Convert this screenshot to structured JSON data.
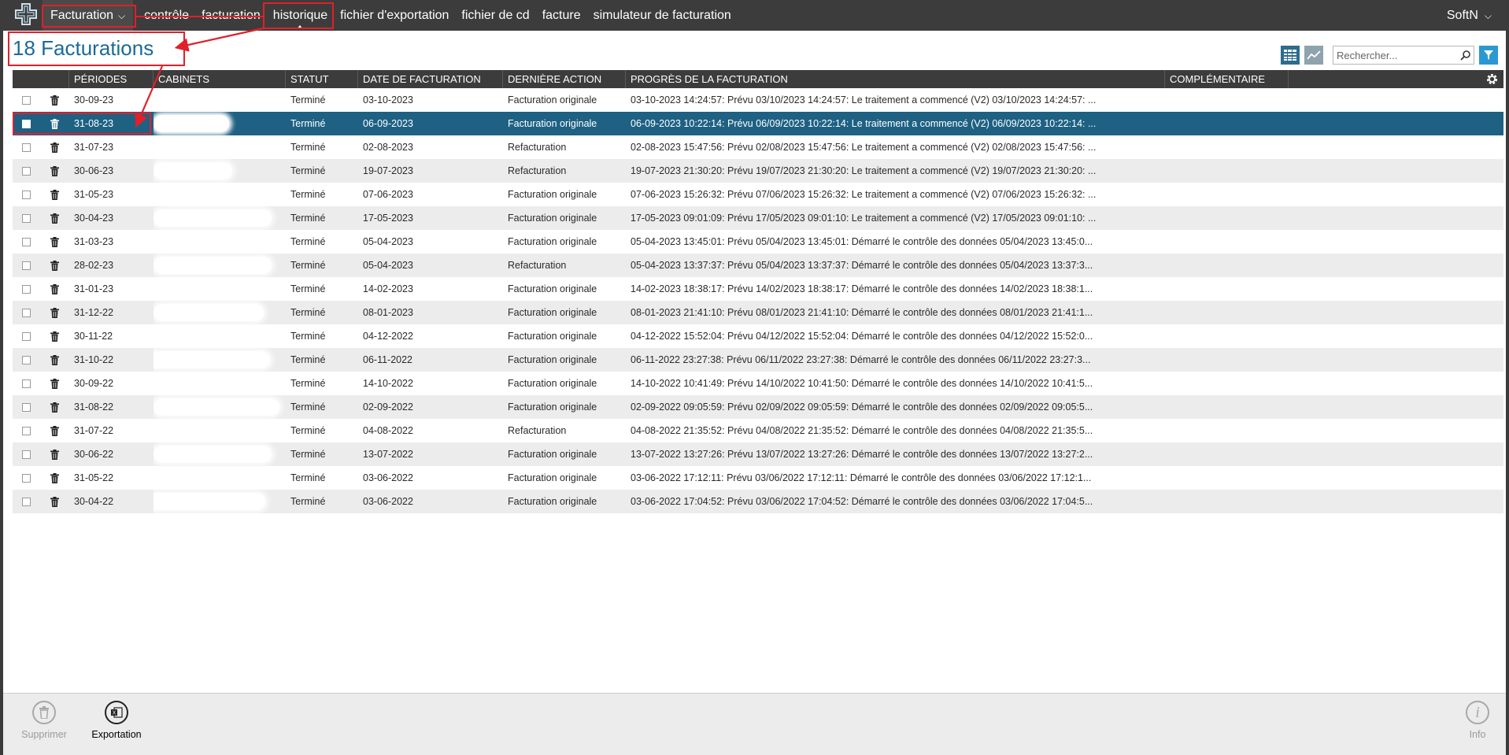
{
  "nav": {
    "module_label": "Facturation",
    "items": [
      "contrôle",
      "facturation",
      "historique",
      "fichier d'exportation",
      "fichier de cd",
      "facture",
      "simulateur de facturation"
    ],
    "active_index": 2,
    "user": "SoftN"
  },
  "page": {
    "title": "18 Facturations"
  },
  "search": {
    "placeholder": "Rechercher..."
  },
  "table": {
    "columns": [
      "PÉRIODES",
      "CABINETS",
      "STATUT",
      "DATE DE FACTURATION",
      "DERNIÈRE ACTION",
      "PROGRÈS DE LA FACTURATION",
      "COMPLÉMENTAIRE"
    ],
    "rows": [
      {
        "period": "30-09-23",
        "status": "Terminé",
        "date": "03-10-2023",
        "action": "Facturation originale",
        "progress": "03-10-2023 14:24:57: Prévu 03/10/2023 14:24:57: Le traitement a commencé (V2) 03/10/2023 14:24:57: ..."
      },
      {
        "period": "31-08-23",
        "status": "Terminé",
        "date": "06-09-2023",
        "action": "Facturation originale",
        "progress": "06-09-2023 10:22:14: Prévu 06/09/2023 10:22:14: Le traitement a commencé (V2) 06/09/2023 10:22:14: ..."
      },
      {
        "period": "31-07-23",
        "status": "Terminé",
        "date": "02-08-2023",
        "action": "Refacturation",
        "progress": "02-08-2023 15:47:56: Prévu 02/08/2023 15:47:56: Le traitement a commencé (V2) 02/08/2023 15:47:56: ..."
      },
      {
        "period": "30-06-23",
        "status": "Terminé",
        "date": "19-07-2023",
        "action": "Refacturation",
        "progress": "19-07-2023 21:30:20: Prévu 19/07/2023 21:30:20: Le traitement a commencé (V2) 19/07/2023 21:30:20: ..."
      },
      {
        "period": "31-05-23",
        "status": "Terminé",
        "date": "07-06-2023",
        "action": "Facturation originale",
        "progress": "07-06-2023 15:26:32: Prévu 07/06/2023 15:26:32: Le traitement a commencé (V2) 07/06/2023 15:26:32: ..."
      },
      {
        "period": "30-04-23",
        "status": "Terminé",
        "date": "17-05-2023",
        "action": "Facturation originale",
        "progress": "17-05-2023 09:01:09: Prévu 17/05/2023 09:01:10: Le traitement a commencé (V2) 17/05/2023 09:01:10: ..."
      },
      {
        "period": "31-03-23",
        "status": "Terminé",
        "date": "05-04-2023",
        "action": "Facturation originale",
        "progress": "05-04-2023 13:45:01: Prévu 05/04/2023 13:45:01: Démarré le contrôle des données 05/04/2023 13:45:0..."
      },
      {
        "period": "28-02-23",
        "status": "Terminé",
        "date": "05-04-2023",
        "action": "Refacturation",
        "progress": "05-04-2023 13:37:37: Prévu 05/04/2023 13:37:37: Démarré le contrôle des données 05/04/2023 13:37:3..."
      },
      {
        "period": "31-01-23",
        "status": "Terminé",
        "date": "14-02-2023",
        "action": "Facturation originale",
        "progress": "14-02-2023 18:38:17: Prévu 14/02/2023 18:38:17: Démarré le contrôle des données 14/02/2023 18:38:1..."
      },
      {
        "period": "31-12-22",
        "status": "Terminé",
        "date": "08-01-2023",
        "action": "Facturation originale",
        "progress": "08-01-2023 21:41:10: Prévu 08/01/2023 21:41:10: Démarré le contrôle des données 08/01/2023 21:41:1..."
      },
      {
        "period": "30-11-22",
        "status": "Terminé",
        "date": "04-12-2022",
        "action": "Facturation originale",
        "progress": "04-12-2022 15:52:04: Prévu 04/12/2022 15:52:04: Démarré le contrôle des données 04/12/2022 15:52:0..."
      },
      {
        "period": "31-10-22",
        "status": "Terminé",
        "date": "06-11-2022",
        "action": "Facturation originale",
        "progress": "06-11-2022 23:27:38: Prévu 06/11/2022 23:27:38: Démarré le contrôle des données 06/11/2022 23:27:3..."
      },
      {
        "period": "30-09-22",
        "status": "Terminé",
        "date": "14-10-2022",
        "action": "Facturation originale",
        "progress": "14-10-2022 10:41:49: Prévu 14/10/2022 10:41:50: Démarré le contrôle des données 14/10/2022 10:41:5..."
      },
      {
        "period": "31-08-22",
        "status": "Terminé",
        "date": "02-09-2022",
        "action": "Facturation originale",
        "progress": "02-09-2022 09:05:59: Prévu 02/09/2022 09:05:59: Démarré le contrôle des données 02/09/2022 09:05:5..."
      },
      {
        "period": "31-07-22",
        "status": "Terminé",
        "date": "04-08-2022",
        "action": "Refacturation",
        "progress": "04-08-2022 21:35:52: Prévu 04/08/2022 21:35:52: Démarré le contrôle des données 04/08/2022 21:35:5..."
      },
      {
        "period": "30-06-22",
        "status": "Terminé",
        "date": "13-07-2022",
        "action": "Facturation originale",
        "progress": "13-07-2022 13:27:26: Prévu 13/07/2022 13:27:26: Démarré le contrôle des données 13/07/2022 13:27:2..."
      },
      {
        "period": "31-05-22",
        "status": "Terminé",
        "date": "03-06-2022",
        "action": "Facturation originale",
        "progress": "03-06-2022 17:12:11: Prévu 03/06/2022 17:12:11: Démarré le contrôle des données 03/06/2022 17:12:1..."
      },
      {
        "period": "30-04-22",
        "status": "Terminé",
        "date": "03-06-2022",
        "action": "Facturation originale",
        "progress": "03-06-2022 17:04:52: Prévu 03/06/2022 17:04:52: Démarré le contrôle des données 03/06/2022 17:04:5..."
      }
    ],
    "selected_index": 1
  },
  "footer": {
    "delete_label": "Supprimer",
    "export_label": "Exportation",
    "info_label": "Info"
  },
  "colors": {
    "topbar": "#3c3c3c",
    "selected_row": "#1e6183",
    "title": "#1a6a9a",
    "annotation": "#e0202a"
  }
}
